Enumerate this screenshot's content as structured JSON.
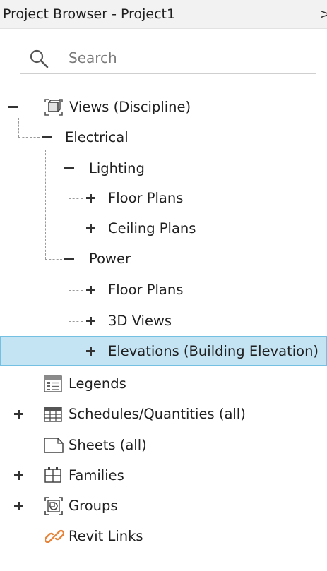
{
  "panel": {
    "title": "Project Browser - Project1",
    "close_glyph": ">"
  },
  "search": {
    "placeholder": "Search",
    "value": ""
  },
  "tree": {
    "views": "Views (Discipline)",
    "electrical": "Electrical",
    "lighting": "Lighting",
    "lighting_floor_plans": "Floor Plans",
    "lighting_ceiling_plans": "Ceiling Plans",
    "power": "Power",
    "power_floor_plans": "Floor Plans",
    "power_3d_views": "3D Views",
    "power_elevations": "Elevations (Building Elevation)",
    "legends": "Legends",
    "schedules": "Schedules/Quantities (all)",
    "sheets": "Sheets (all)",
    "families": "Families",
    "groups": "Groups",
    "revit_links": "Revit Links"
  },
  "colors": {
    "selection_bg": "#c4e4f4",
    "selection_border": "#73c0e2",
    "link_icon": "#e8843a"
  }
}
